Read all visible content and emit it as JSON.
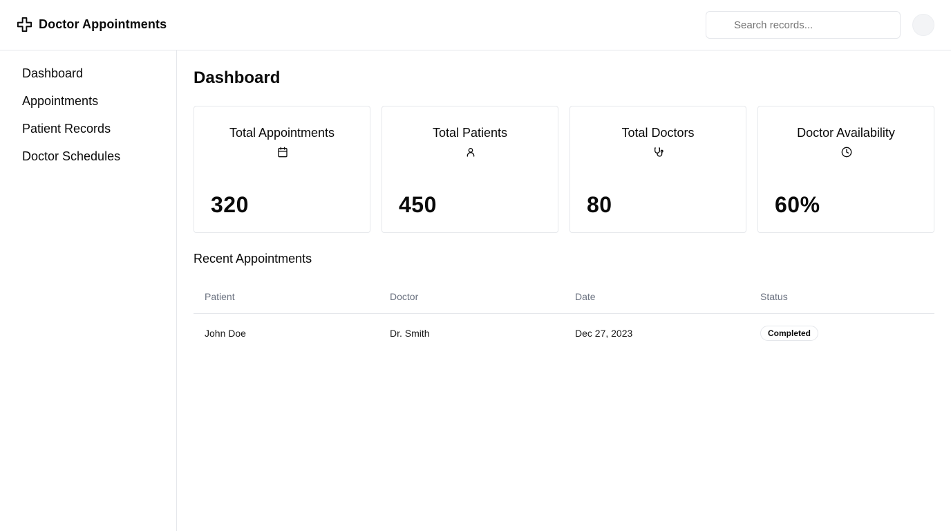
{
  "header": {
    "brand_icon": "plus-cross-icon",
    "title": "Doctor Appointments",
    "search_placeholder": "Search records...",
    "search_value": ""
  },
  "sidebar": {
    "items": [
      {
        "label": "Dashboard"
      },
      {
        "label": "Appointments"
      },
      {
        "label": "Patient Records"
      },
      {
        "label": "Doctor Schedules"
      }
    ]
  },
  "main": {
    "title": "Dashboard",
    "cards": [
      {
        "title": "Total Appointments",
        "icon": "calendar-icon",
        "value": "320"
      },
      {
        "title": "Total Patients",
        "icon": "user-icon",
        "value": "450"
      },
      {
        "title": "Total Doctors",
        "icon": "stethoscope-icon",
        "value": "80"
      },
      {
        "title": "Doctor Availability",
        "icon": "clock-icon",
        "value": "60%"
      }
    ],
    "recent": {
      "title": "Recent Appointments",
      "columns": [
        "Patient",
        "Doctor",
        "Date",
        "Status"
      ],
      "rows": [
        {
          "patient": "John Doe",
          "doctor": "Dr. Smith",
          "date": "Dec 27, 2023",
          "status": "Completed"
        }
      ]
    }
  }
}
